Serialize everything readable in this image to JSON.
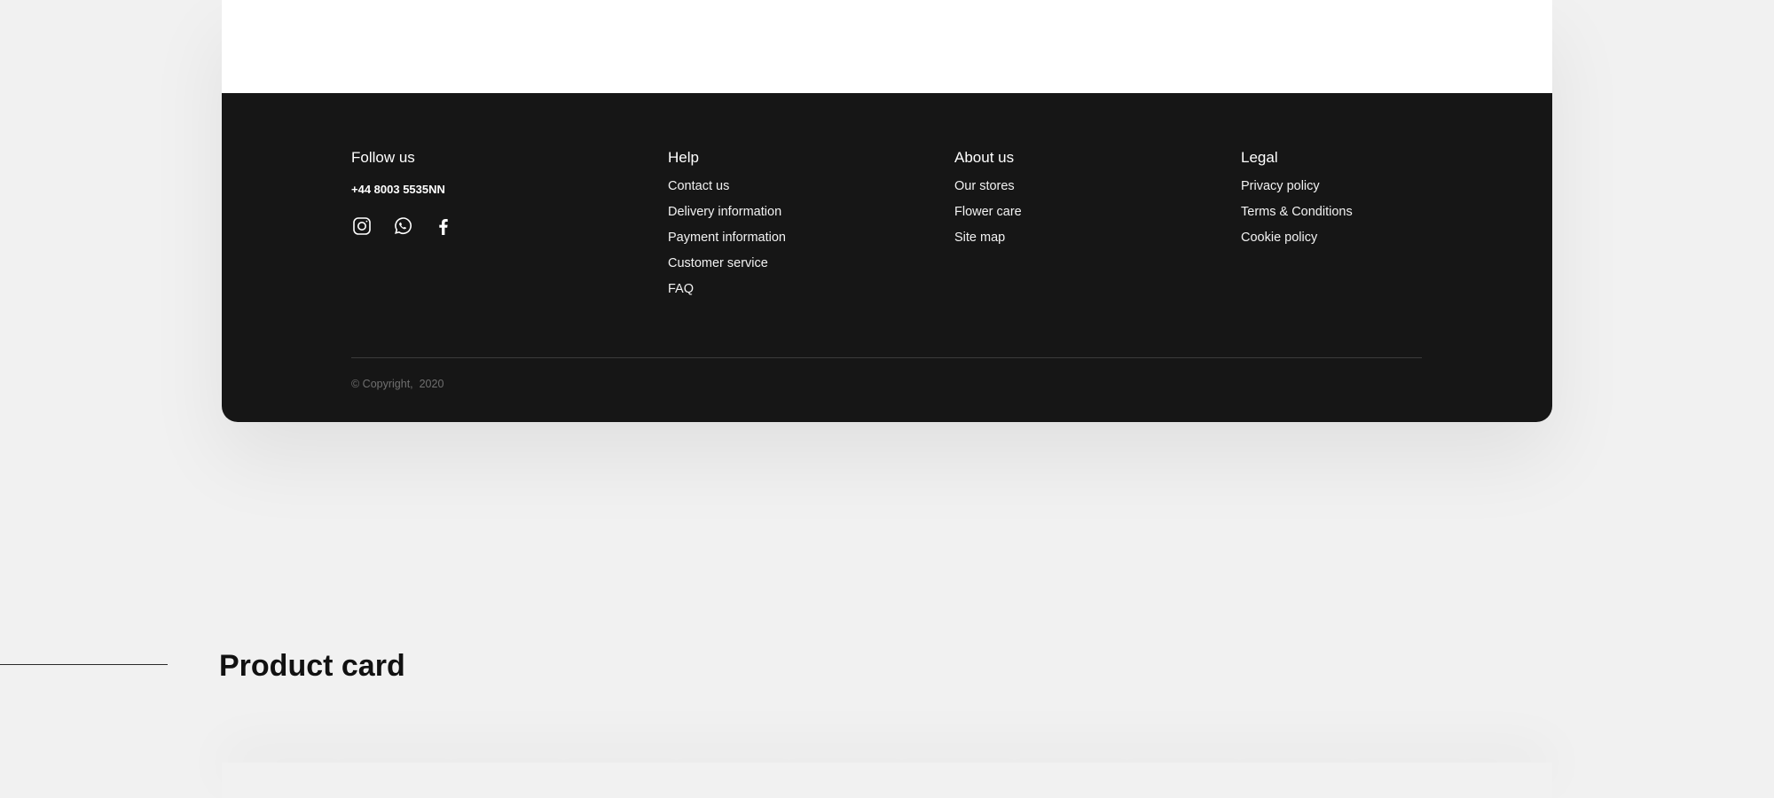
{
  "footer": {
    "follow": {
      "title": "Follow us",
      "phone": "+44 8003 5535NN",
      "social": [
        "instagram-icon",
        "whatsapp-icon",
        "facebook-icon"
      ]
    },
    "help": {
      "title": "Help",
      "links": [
        "Contact us",
        "Delivery information",
        "Payment information",
        "Customer service",
        "FAQ"
      ]
    },
    "about": {
      "title": "About us",
      "links": [
        "Our stores",
        "Flower care",
        "Site map"
      ]
    },
    "legal": {
      "title": "Legal",
      "links": [
        "Privacy policy",
        "Terms & Conditions",
        "Cookie policy"
      ]
    },
    "copyright": "© Copyright,  2020"
  },
  "section": {
    "title": "Product card"
  },
  "colors": {
    "page_background": "#f1f1f1",
    "footer_background": "#161616",
    "card_background": "#ffffff"
  }
}
